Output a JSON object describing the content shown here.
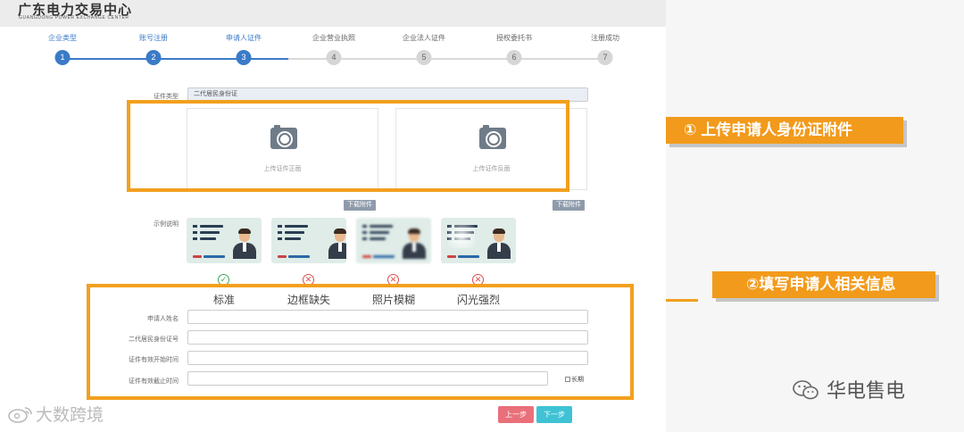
{
  "header": {
    "logo_cn": "广东电力交易中心",
    "logo_en": "GUANGDONG POWER EXCHANGE CENTER"
  },
  "steps": [
    {
      "label": "企业类型",
      "num": "1"
    },
    {
      "label": "账号注册",
      "num": "2"
    },
    {
      "label": "申请人证件",
      "num": "3"
    },
    {
      "label": "企业营业执照",
      "num": "4"
    },
    {
      "label": "企业法人证件",
      "num": "5"
    },
    {
      "label": "授权委托书",
      "num": "6"
    },
    {
      "label": "注册成功",
      "num": "7"
    }
  ],
  "current_step": 3,
  "cert_type": {
    "label": "证件类型",
    "value": "二代居民身份证"
  },
  "upload": {
    "front_text": "上传证件正面",
    "back_text": "上传证件反面",
    "download_label": "下载附件"
  },
  "example": {
    "label": "示例说明",
    "captions": [
      "标准",
      "边框缺失",
      "照片模糊",
      "闪光强烈"
    ],
    "marks": [
      "✓",
      "✕",
      "✕",
      "✕"
    ]
  },
  "form": {
    "name_label": "申请人姓名",
    "id_label": "二代居民身份证号",
    "start_label": "证件有效开始时间",
    "end_label": "证件有效截止时间",
    "long_term_label": "长期"
  },
  "buttons": {
    "prev": "上一步",
    "next": "下一步"
  },
  "callouts": {
    "c1": "① 上传申请人身份证附件",
    "c2": "②填写申请人相关信息"
  },
  "brand": "华电售电",
  "watermark": "大数跨境",
  "colors": {
    "accent": "#3a7bc8",
    "highlight": "#f2a01e",
    "prev_button": "#e9707a",
    "next_button": "#3fc2d4"
  }
}
